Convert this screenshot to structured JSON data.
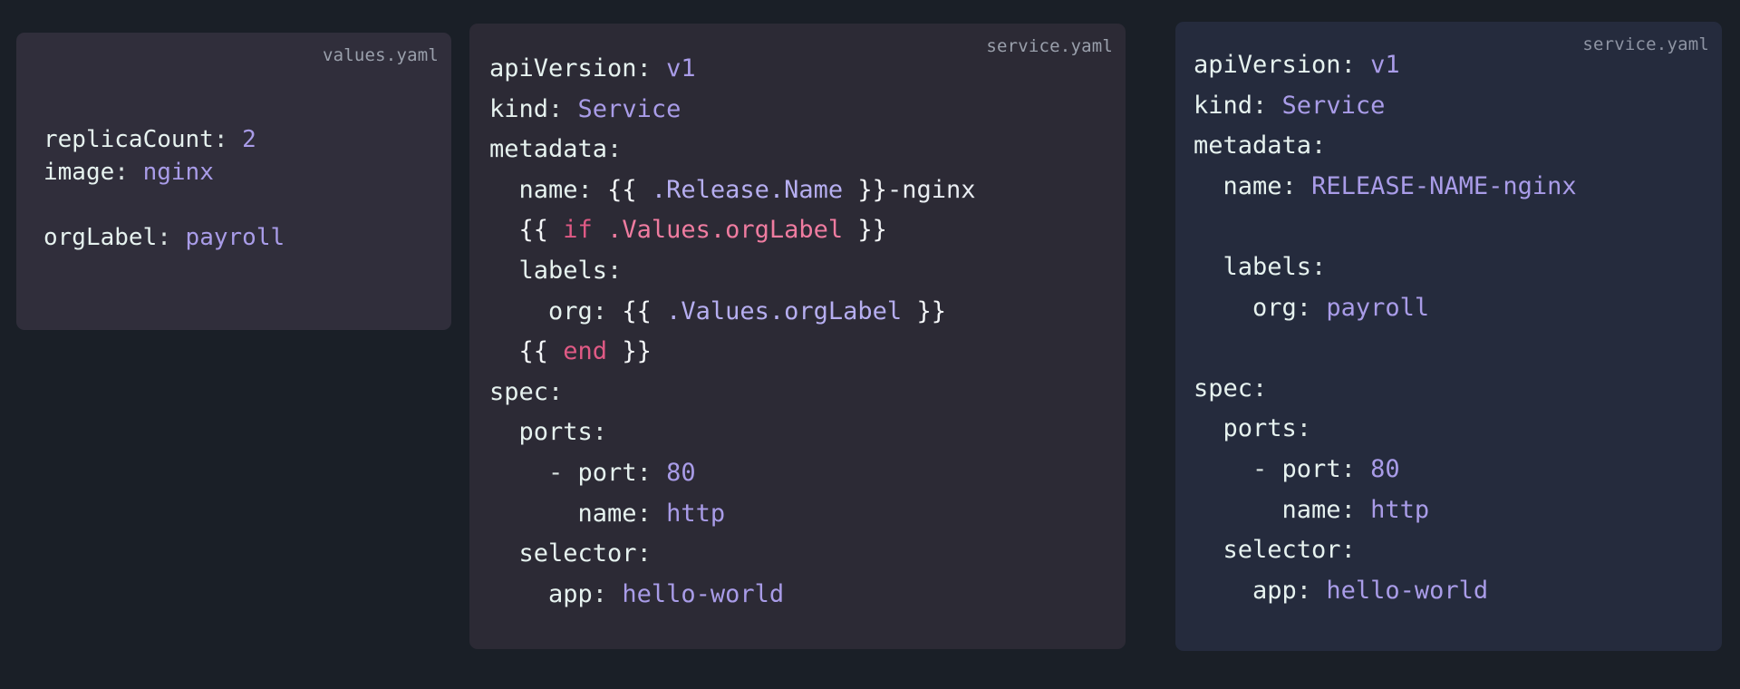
{
  "panels": [
    {
      "id": "values",
      "filename": "values.yaml",
      "lines": [
        [
          {
            "t": "replicaCount",
            "c": "k"
          },
          {
            "t": ": ",
            "c": "p"
          },
          {
            "t": "2",
            "c": "num"
          }
        ],
        [
          {
            "t": "image",
            "c": "k"
          },
          {
            "t": ": ",
            "c": "p"
          },
          {
            "t": "nginx",
            "c": "v"
          }
        ],
        [],
        [
          {
            "t": "orgLabel",
            "c": "k"
          },
          {
            "t": ": ",
            "c": "p"
          },
          {
            "t": "payroll",
            "c": "v"
          }
        ]
      ]
    },
    {
      "id": "template",
      "filename": "service.yaml",
      "lines": [
        [
          {
            "t": "apiVersion",
            "c": "k"
          },
          {
            "t": ": ",
            "c": "p"
          },
          {
            "t": "v1",
            "c": "v"
          }
        ],
        [
          {
            "t": "kind",
            "c": "k"
          },
          {
            "t": ": ",
            "c": "p"
          },
          {
            "t": "Service",
            "c": "v"
          }
        ],
        [
          {
            "t": "metadata",
            "c": "k"
          },
          {
            "t": ":",
            "c": "p"
          }
        ],
        [
          {
            "t": "  name",
            "c": "k"
          },
          {
            "t": ": ",
            "c": "p"
          },
          {
            "t": "{{ ",
            "c": "br"
          },
          {
            "t": ".Release.Name",
            "c": "tpl"
          },
          {
            "t": " }}",
            "c": "br"
          },
          {
            "t": "-nginx",
            "c": "plain"
          }
        ],
        [
          {
            "t": "  ",
            "c": "p"
          },
          {
            "t": "{{ ",
            "c": "br"
          },
          {
            "t": "if",
            "c": "kw"
          },
          {
            "t": " ",
            "c": "p"
          },
          {
            "t": ".Values.orgLabel",
            "c": "kwa"
          },
          {
            "t": " }}",
            "c": "br"
          }
        ],
        [
          {
            "t": "  labels",
            "c": "k"
          },
          {
            "t": ":",
            "c": "p"
          }
        ],
        [
          {
            "t": "    org",
            "c": "k"
          },
          {
            "t": ": ",
            "c": "p"
          },
          {
            "t": "{{ ",
            "c": "br"
          },
          {
            "t": ".Values.orgLabel",
            "c": "tpl"
          },
          {
            "t": " }}",
            "c": "br"
          }
        ],
        [
          {
            "t": "  ",
            "c": "p"
          },
          {
            "t": "{{ ",
            "c": "br"
          },
          {
            "t": "end",
            "c": "kw"
          },
          {
            "t": " }}",
            "c": "br"
          }
        ],
        [
          {
            "t": "spec",
            "c": "k"
          },
          {
            "t": ":",
            "c": "p"
          }
        ],
        [
          {
            "t": "  ports",
            "c": "k"
          },
          {
            "t": ":",
            "c": "p"
          }
        ],
        [
          {
            "t": "    - ",
            "c": "p"
          },
          {
            "t": "port",
            "c": "k"
          },
          {
            "t": ": ",
            "c": "p"
          },
          {
            "t": "80",
            "c": "num"
          }
        ],
        [
          {
            "t": "      name",
            "c": "k"
          },
          {
            "t": ": ",
            "c": "p"
          },
          {
            "t": "http",
            "c": "v"
          }
        ],
        [
          {
            "t": "  selector",
            "c": "k"
          },
          {
            "t": ":",
            "c": "p"
          }
        ],
        [
          {
            "t": "    app",
            "c": "k"
          },
          {
            "t": ": ",
            "c": "p"
          },
          {
            "t": "hello-world",
            "c": "v"
          }
        ]
      ]
    },
    {
      "id": "rendered",
      "filename": "service.yaml",
      "lines": [
        [
          {
            "t": "apiVersion",
            "c": "k"
          },
          {
            "t": ": ",
            "c": "p"
          },
          {
            "t": "v1",
            "c": "v"
          }
        ],
        [
          {
            "t": "kind",
            "c": "k"
          },
          {
            "t": ": ",
            "c": "p"
          },
          {
            "t": "Service",
            "c": "v"
          }
        ],
        [
          {
            "t": "metadata",
            "c": "k"
          },
          {
            "t": ":",
            "c": "p"
          }
        ],
        [
          {
            "t": "  name",
            "c": "k"
          },
          {
            "t": ": ",
            "c": "p"
          },
          {
            "t": "RELEASE-NAME-nginx",
            "c": "v"
          }
        ],
        [],
        [
          {
            "t": "  labels",
            "c": "k"
          },
          {
            "t": ":",
            "c": "p"
          }
        ],
        [
          {
            "t": "    org",
            "c": "k"
          },
          {
            "t": ": ",
            "c": "p"
          },
          {
            "t": "payroll",
            "c": "v"
          }
        ],
        [],
        [
          {
            "t": "spec",
            "c": "k"
          },
          {
            "t": ":",
            "c": "p"
          }
        ],
        [
          {
            "t": "  ports",
            "c": "k"
          },
          {
            "t": ":",
            "c": "p"
          }
        ],
        [
          {
            "t": "    - ",
            "c": "p"
          },
          {
            "t": "port",
            "c": "k"
          },
          {
            "t": ": ",
            "c": "p"
          },
          {
            "t": "80",
            "c": "num"
          }
        ],
        [
          {
            "t": "      name",
            "c": "k"
          },
          {
            "t": ": ",
            "c": "p"
          },
          {
            "t": "http",
            "c": "v"
          }
        ],
        [
          {
            "t": "  selector",
            "c": "k"
          },
          {
            "t": ":",
            "c": "p"
          }
        ],
        [
          {
            "t": "    app",
            "c": "k"
          },
          {
            "t": ": ",
            "c": "p"
          },
          {
            "t": "hello-world",
            "c": "v"
          }
        ]
      ]
    }
  ],
  "colors": {
    "page_background": "#1a1f27",
    "panel_values_bg": "#302e3b",
    "panel_template_bg": "#2c2a35",
    "panel_rendered_bg": "#252b3d",
    "key": "#e6f2ef",
    "value": "#a99ce8",
    "template_expr": "#b6aef0",
    "keyword": "#e05a85",
    "keyword_path": "#ef7ca0",
    "braces": "#f4f6f8",
    "filename_label": "#9aa0ac"
  }
}
